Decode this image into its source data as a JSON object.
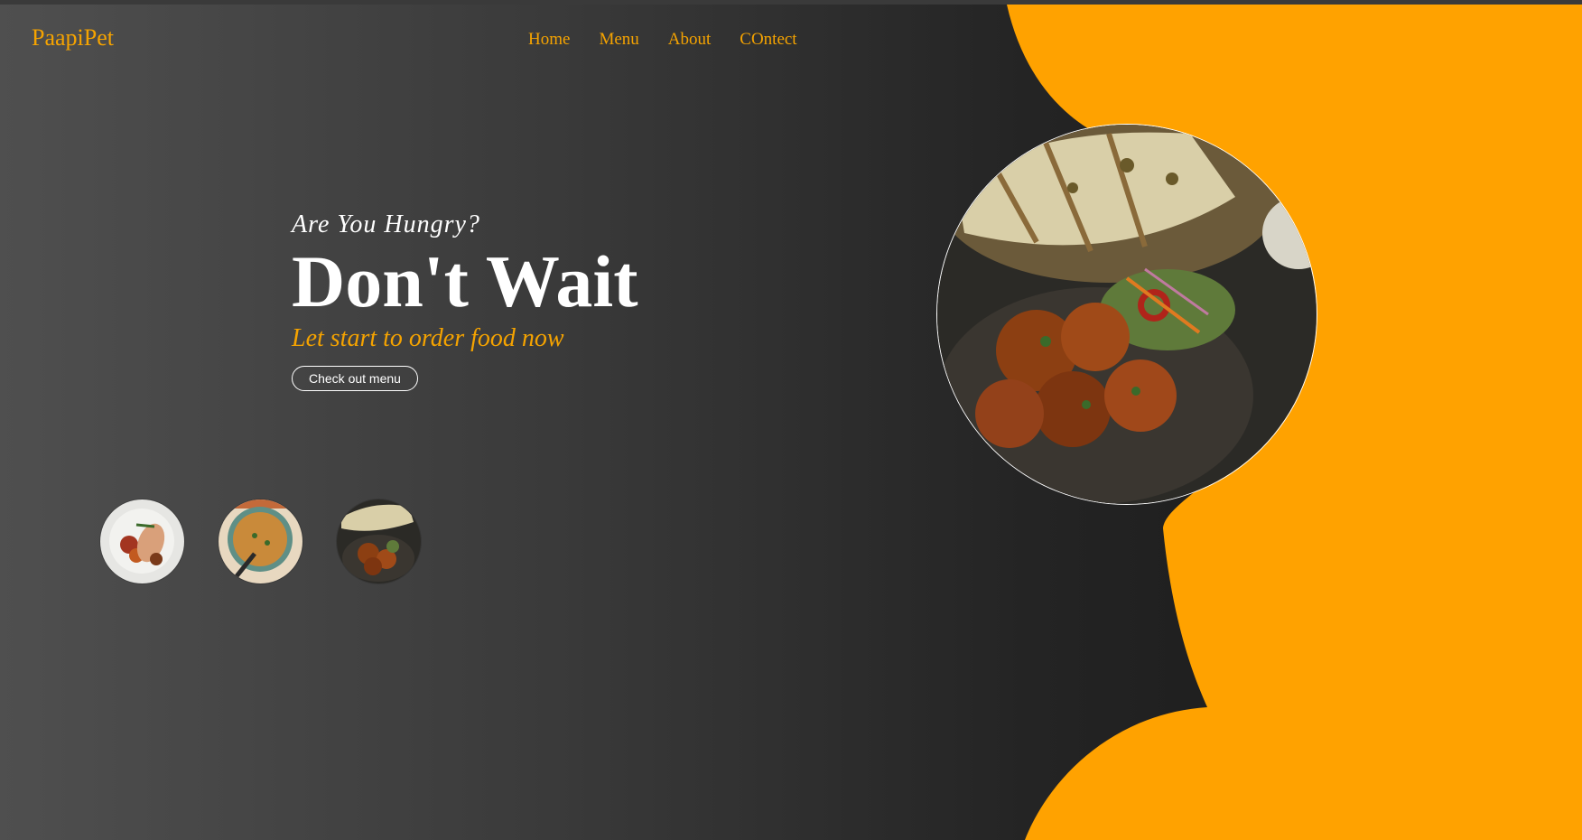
{
  "brand": {
    "name": "PaapiPet"
  },
  "nav": {
    "items": [
      "Home",
      "Menu",
      "About",
      "COntect"
    ]
  },
  "hero": {
    "kicker": "Are You Hungry?",
    "title": "Don't Wait",
    "tagline": "Let start to order food now",
    "cta_label": "Check out menu"
  },
  "images": {
    "main": "food-platter-image",
    "thumbs": [
      "grilled-chicken-thumbnail",
      "biryani-thumbnail",
      "pakora-platter-thumbnail"
    ]
  },
  "colors": {
    "accent": "#f5a300",
    "text": "#ffffff"
  }
}
